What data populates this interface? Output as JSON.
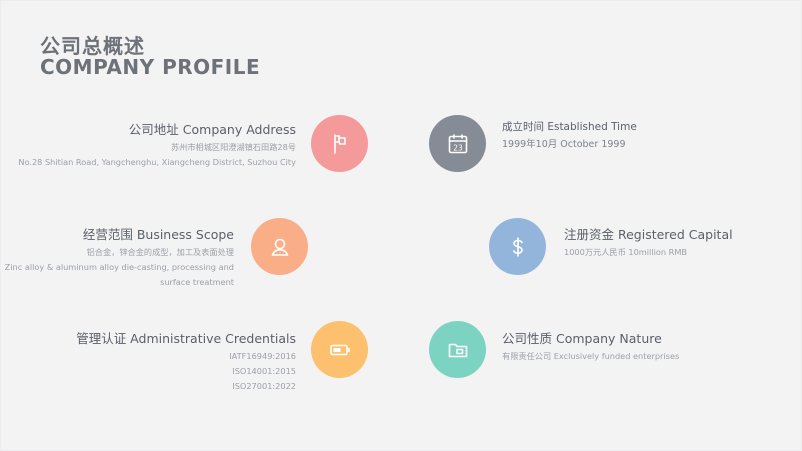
{
  "header": {
    "title_cn": "公司总概述",
    "title_en": "COMPANY PROFILE"
  },
  "items": {
    "address": {
      "title": "公司地址 Company Address",
      "line1": "苏州市相城区阳澄湖镇石田路28号",
      "line2": "No.28 Shitian Road, Yangchenghu, Xiangcheng District, Suzhou City",
      "icon": "flag-icon",
      "color": "#f59a9a"
    },
    "established": {
      "title": "成立时间 Established Time",
      "line1": "1999年10月  October 1999",
      "icon": "calendar-icon",
      "icon_text": "23",
      "color": "#858c95"
    },
    "scope": {
      "title": "经营范围 Business Scope",
      "line1": "铝合金，锌合金的成型，加工及表面处理",
      "line2": "Zinc alloy & aluminum alloy die-casting, processing and surface treatment",
      "icon": "user-icon",
      "color": "#f9ae87"
    },
    "capital": {
      "title": "注册资金 Registered Capital",
      "line1": "1000万元人民币  10million RMB",
      "icon": "dollar-icon",
      "color": "#93b5dc"
    },
    "credentials": {
      "title": "管理认证 Administrative Credentials",
      "lines": [
        "IATF16949:2016",
        "ISO14001:2015",
        "ISO27001:2022"
      ],
      "icon": "battery-icon",
      "color": "#fcc06f"
    },
    "nature": {
      "title": "公司性质 Company Nature",
      "line1": "有限责任公司 Exclusively funded enterprises",
      "icon": "folder-icon",
      "color": "#7dd3c2"
    }
  }
}
